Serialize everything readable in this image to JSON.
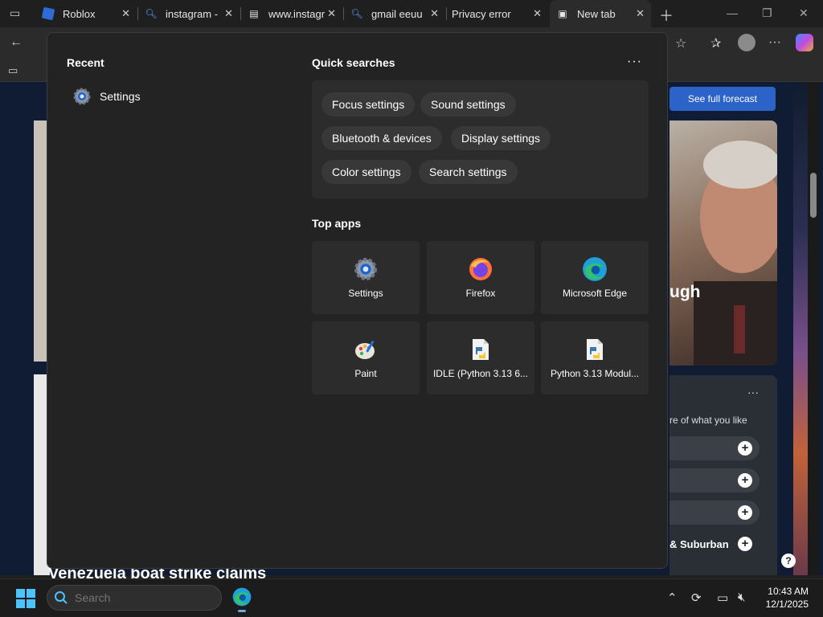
{
  "tabs": [
    {
      "title": "Roblox",
      "favicon": "roblox-icon"
    },
    {
      "title": "instagram -",
      "favicon": "search-icon"
    },
    {
      "title": "www.instagr",
      "favicon": "document-icon"
    },
    {
      "title": "gmail eeuu",
      "favicon": "search-icon"
    },
    {
      "title": "Privacy error",
      "favicon": "none"
    },
    {
      "title": "New tab",
      "favicon": "newtab-icon"
    }
  ],
  "page": {
    "forecast_button": "See full forecast",
    "news_headline_fragment": "ugh",
    "interest_subtitle": "re of what you like",
    "interest_label": "& Suburban",
    "bottom_headline": "Venezuela boat strike claims"
  },
  "start_menu": {
    "recent_title": "Recent",
    "recent_items": [
      {
        "label": "Settings",
        "icon": "settings-gear-icon"
      }
    ],
    "quick_searches_title": "Quick searches",
    "more_label": "···",
    "quick_searches": [
      "Focus settings",
      "Sound settings",
      "Bluetooth & devices",
      "Display settings",
      "Color settings",
      "Search settings"
    ],
    "top_apps_title": "Top apps",
    "top_apps": [
      {
        "label": "Settings",
        "icon": "settings-gear-icon"
      },
      {
        "label": "Firefox",
        "icon": "firefox-icon"
      },
      {
        "label": "Microsoft Edge",
        "icon": "edge-icon"
      },
      {
        "label": "Paint",
        "icon": "paint-palette-icon"
      },
      {
        "label": "IDLE (Python 3.13 6...",
        "icon": "python-file-icon"
      },
      {
        "label": "Python 3.13 Modul...",
        "icon": "python-file-icon"
      }
    ]
  },
  "taskbar": {
    "search_placeholder": "Search",
    "time": "10:43 AM",
    "date": "12/1/2025"
  },
  "colors": {
    "accent": "#4cc2ff",
    "forecast_button": "#2b63c8",
    "start_bg": "#232323"
  }
}
